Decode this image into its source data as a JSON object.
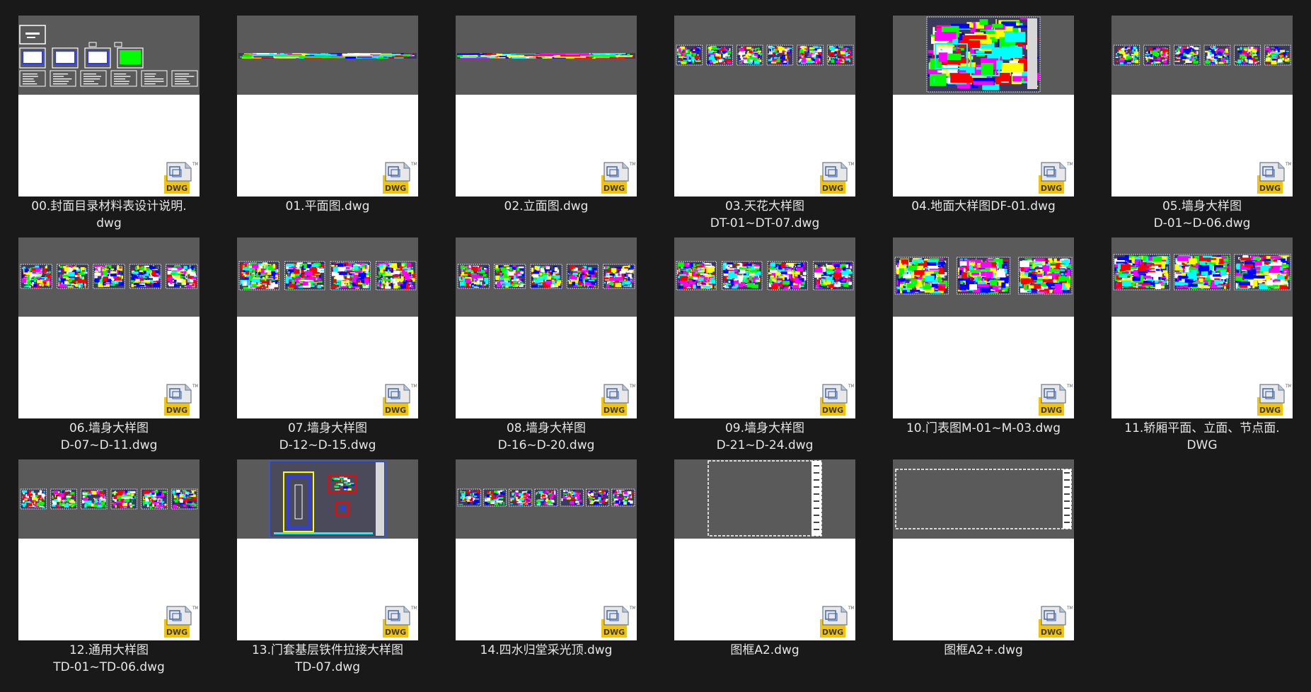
{
  "window": {
    "background": "#191919"
  },
  "badge": {
    "text": "DWG",
    "tm": "TM",
    "icon": "dwg-file-icon"
  },
  "colors": {
    "preview_bg": "#5a5a5a",
    "caption": "#e6e6e6",
    "cad": [
      "#00ff00",
      "#ffff00",
      "#00ffff",
      "#ff0000",
      "#ffffff",
      "#0000ff",
      "#ff00ff"
    ]
  },
  "files": [
    {
      "name": "00.封面目录材料表设计说明.\ndwg",
      "preview": "cover"
    },
    {
      "name": "01.平面图.dwg",
      "preview": "thin"
    },
    {
      "name": "02.立面图.dwg",
      "preview": "thin"
    },
    {
      "name": "03.天花大样图\nDT-01~DT-07.dwg",
      "preview": "sheets-6"
    },
    {
      "name": "04.地面大样图DF-01.dwg",
      "preview": "single"
    },
    {
      "name": "05.墙身大样图\nD-01~D-06.dwg",
      "preview": "sheets-6"
    },
    {
      "name": "06.墙身大样图\nD-07~D-11.dwg",
      "preview": "sheets-5"
    },
    {
      "name": "07.墙身大样图\nD-12~D-15.dwg",
      "preview": "sheets-4"
    },
    {
      "name": "08.墙身大样图\nD-16~D-20.dwg",
      "preview": "sheets-5"
    },
    {
      "name": "09.墙身大样图\nD-21~D-24.dwg",
      "preview": "sheets-4"
    },
    {
      "name": "10.门表图M-01~M-03.dwg",
      "preview": "sheets-3"
    },
    {
      "name": "11.轿厢平面、立面、节点面.\nDWG",
      "preview": "sheets-3b"
    },
    {
      "name": "12.通用大样图\nTD-01~TD-06.dwg",
      "preview": "sheets-6"
    },
    {
      "name": "13.门套基层铁件拉接大样图\nTD-07.dwg",
      "preview": "door"
    },
    {
      "name": "14.四水归堂采光顶.dwg",
      "preview": "sheets-7"
    },
    {
      "name": "图框A2.dwg",
      "preview": "frame-portrait"
    },
    {
      "name": "图框A2+.dwg",
      "preview": "frame-landscape"
    }
  ]
}
